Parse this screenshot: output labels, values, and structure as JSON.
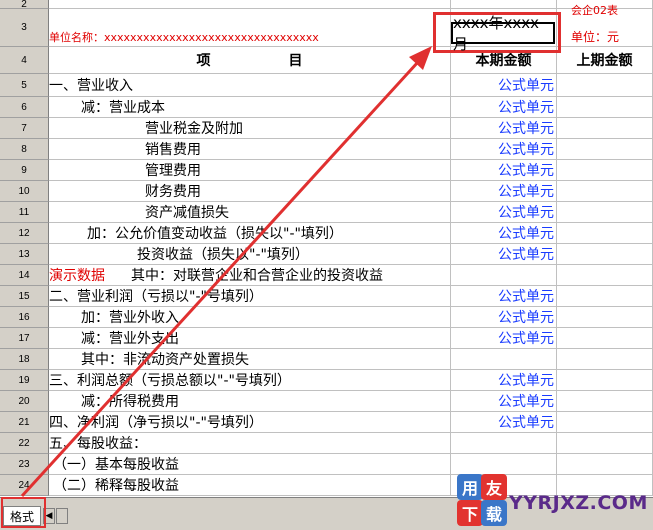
{
  "header": {
    "form_code": "会企02表",
    "unit_name": "单位名称：xxxxxxxxxxxxxxxxxxxxxxxxxxxxxxxxx",
    "period": "xxxx年xxxx月",
    "currency_unit": "单位：元",
    "col_item": "项                目",
    "col_current": "本期金额",
    "col_prior": "上期金额"
  },
  "rows": [
    {
      "num": "2"
    },
    {
      "num": "3"
    },
    {
      "num": "4"
    },
    {
      "num": "5",
      "item": "一、营业收入",
      "value": "公式单元"
    },
    {
      "num": "6",
      "item": "减：营业成本",
      "value": "公式单元"
    },
    {
      "num": "7",
      "item": "营业税金及附加",
      "value": "公式单元"
    },
    {
      "num": "8",
      "item": "销售费用",
      "value": "公式单元"
    },
    {
      "num": "9",
      "item": "管理费用",
      "value": "公式单元"
    },
    {
      "num": "10",
      "item": "财务费用",
      "value": "公式单元"
    },
    {
      "num": "11",
      "item": "资产减值损失",
      "value": "公式单元"
    },
    {
      "num": "12",
      "item": "加：公允价值变动收益（损失以\"-\"填列）",
      "value": "公式单元"
    },
    {
      "num": "13",
      "item": "投资收益（损失以\"-\"填列）",
      "value": "公式单元"
    },
    {
      "num": "14",
      "item": "其中：对联营企业和合营企业的投资收益",
      "value": "",
      "note": "演示数据"
    },
    {
      "num": "15",
      "item": "二、营业利润（亏损以\"-\"号填列）",
      "value": "公式单元"
    },
    {
      "num": "16",
      "item": "加：营业外收入",
      "value": "公式单元"
    },
    {
      "num": "17",
      "item": "减：营业外支出",
      "value": "公式单元"
    },
    {
      "num": "18",
      "item": "其中：非流动资产处置损失",
      "value": ""
    },
    {
      "num": "19",
      "item": "三、利润总额（亏损总额以\"-\"号填列）",
      "value": "公式单元"
    },
    {
      "num": "20",
      "item": "减：所得税费用",
      "value": "公式单元"
    },
    {
      "num": "21",
      "item": "四、净利润（净亏损以\"-\"号填列）",
      "value": "公式单元"
    },
    {
      "num": "22",
      "item": "五、每股收益：",
      "value": ""
    },
    {
      "num": "23",
      "item": "（一）基本每股收益",
      "value": ""
    },
    {
      "num": "24",
      "item": "（二）稀释每股收益",
      "value": ""
    }
  ],
  "sheet_tab": "格式",
  "watermark": {
    "badge_1": "用",
    "badge_2": "友",
    "badge_3": "下",
    "badge_4": "载",
    "site": "YYRJXZ.COM"
  },
  "colors": {
    "annotation_red": "#e03030",
    "formula_blue": "#1a3cff",
    "header_gray": "#d4d0c8"
  }
}
